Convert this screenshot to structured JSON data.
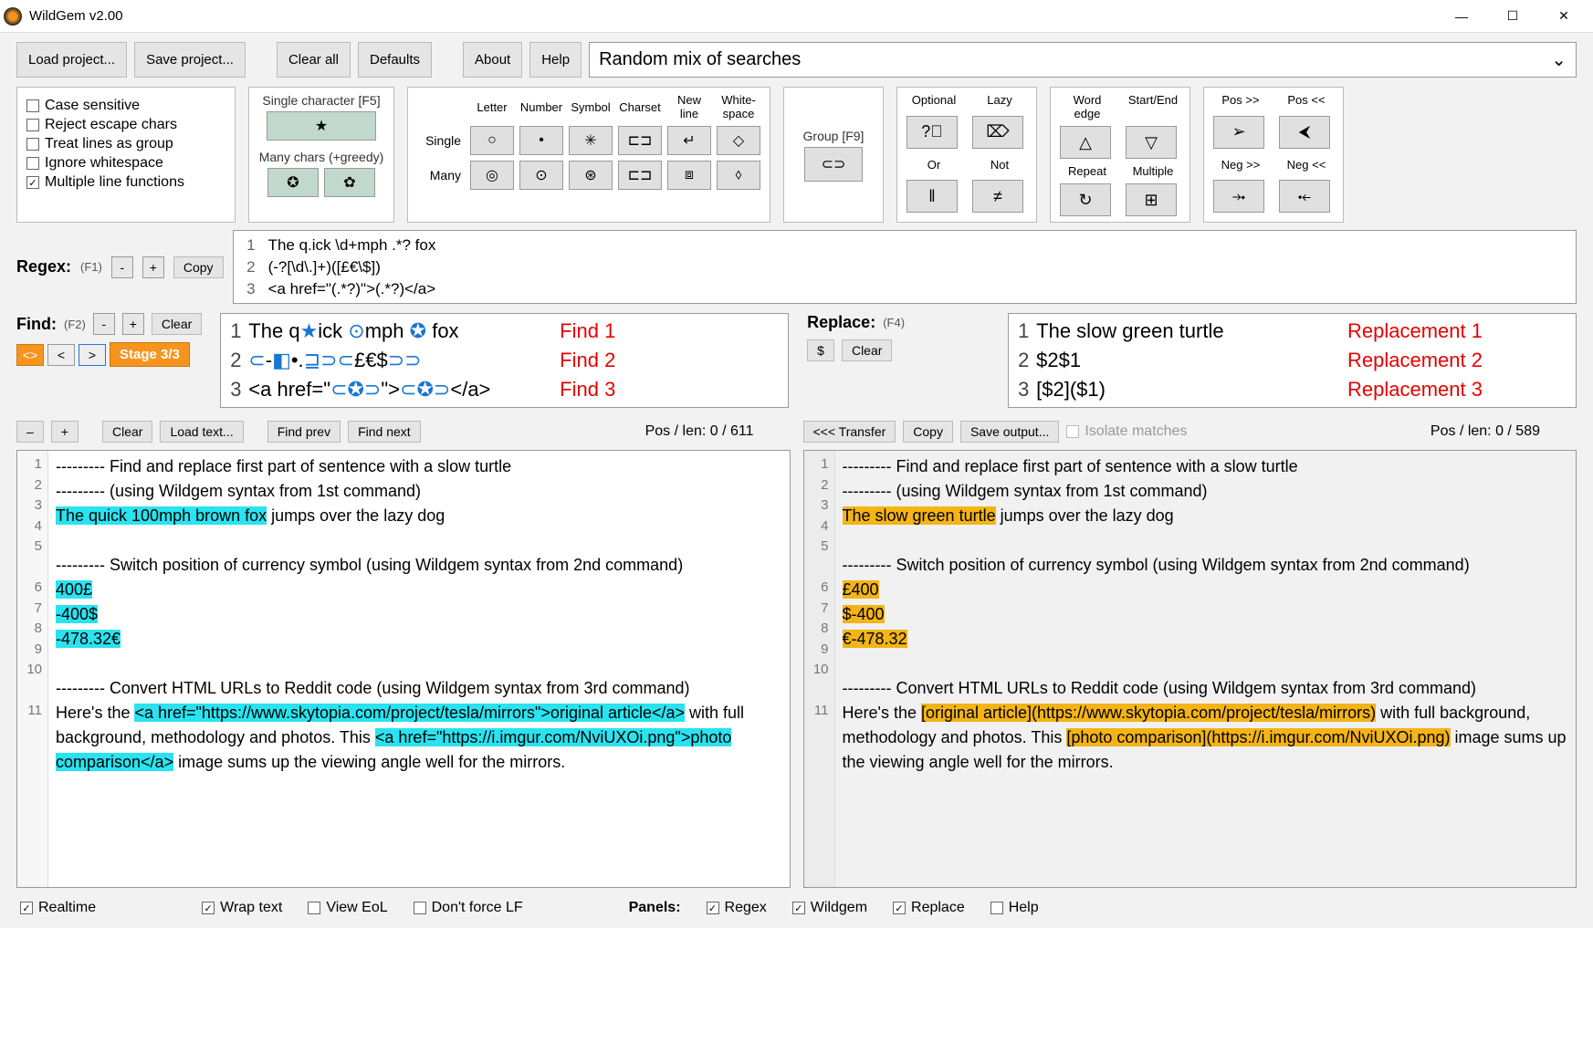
{
  "title": "WildGem v2.00",
  "toolbar": {
    "load": "Load project...",
    "save": "Save project...",
    "clear_all": "Clear all",
    "defaults": "Defaults",
    "about": "About",
    "help": "Help",
    "dropdown_selected": "Random mix of searches"
  },
  "options": {
    "case_sensitive": "Case sensitive",
    "reject_escape": "Reject escape chars",
    "treat_lines": "Treat lines as group",
    "ignore_ws": "Ignore whitespace",
    "multiline": "Multiple line functions"
  },
  "char_section": {
    "single_lbl": "Single character [F5]",
    "many_lbl": "Many chars  (+greedy)",
    "row_single": "Single",
    "row_many": "Many",
    "hdr_letter": "Letter",
    "hdr_number": "Number",
    "hdr_symbol": "Symbol",
    "hdr_charset": "Charset",
    "hdr_newline": "New line",
    "hdr_white": "White-\nspace",
    "group_lbl": "Group [F9]"
  },
  "mods": {
    "optional": "Optional",
    "lazy": "Lazy",
    "or": "Or",
    "not": "Not",
    "wordedge": "Word edge",
    "startend": "Start/End",
    "repeat": "Repeat",
    "multiple": "Multiple",
    "posf": "Pos >>",
    "posb": "Pos <<",
    "negf": "Neg >>",
    "negb": "Neg <<"
  },
  "regex": {
    "label": "Regex:",
    "hint": "(F1)",
    "copy": "Copy",
    "lines": [
      "The q.ick \\d+mph .*? fox",
      "(-?[\\d\\.]+)([£€\\$])",
      "<a href=\"(.*?)\">(.*?)</a>"
    ]
  },
  "find": {
    "label": "Find:",
    "hint": "(F2)",
    "clear": "Clear",
    "stage": "Stage 3/3",
    "lines": [
      {
        "txt": "The q★ick ⊙mph ✪ fox",
        "rl": "Find 1"
      },
      {
        "txt": "⊂-◧•.⊒⊃⊂£€$⊃⊃",
        "rl": "Find 2"
      },
      {
        "txt": "<a href=\"⊂✪⊃\">⊂✪⊃</a>",
        "rl": "Find 3"
      }
    ]
  },
  "replace": {
    "label": "Replace:",
    "hint": "(F4)",
    "dollar": "$",
    "clear": "Clear",
    "lines": [
      {
        "txt": "The slow green turtle",
        "rl": "Replacement 1"
      },
      {
        "txt": "$2$1",
        "rl": "Replacement 2"
      },
      {
        "txt": "[$2]($1)",
        "rl": "Replacement 3"
      }
    ]
  },
  "left_editor": {
    "btn_minus": "–",
    "btn_plus": "+",
    "clear": "Clear",
    "load": "Load text...",
    "prev": "Find prev",
    "next": "Find next",
    "pos": "Pos / len: 0 / 611"
  },
  "right_editor": {
    "transfer": "<<< Transfer",
    "copy": "Copy",
    "save": "Save output...",
    "isolate": "Isolate matches",
    "pos": "Pos / len: 0 / 589"
  },
  "text_left": {
    "l1": "--------- Find and replace first part of sentence with a slow turtle",
    "l2": "--------- (using Wildgem syntax from 1st command)",
    "l3a": "The quick 100mph brown fox",
    "l3b": " jumps over the lazy dog",
    "l5": "--------- Switch position of currency symbol (using Wildgem syntax from 2nd command)",
    "l6": "400£",
    "l7": "-400$",
    "l8": "-478.32€",
    "l10": "--------- Convert HTML URLs to Reddit code (using Wildgem syntax from 3rd command)",
    "l11a": "Here's the ",
    "l11b": "<a href=\"https://www.skytopia.com/project/tesla/mirrors\">original article</a>",
    "l11c": " with full background, methodology and photos. This ",
    "l11d": "<a href=\"https://i.imgur.com/NviUXOi.png\">photo comparison</a>",
    "l11e": " image sums up the viewing angle well for the mirrors."
  },
  "text_right": {
    "l1": "--------- Find and replace first part of sentence with a slow turtle",
    "l2": "--------- (using Wildgem syntax from 1st command)",
    "l3a": "The slow green turtle",
    "l3b": " jumps over the lazy dog",
    "l5": "--------- Switch position of currency symbol (using Wildgem syntax from 2nd command)",
    "l6": "£400",
    "l7": "$-400",
    "l8": "€-478.32",
    "l10": "--------- Convert HTML URLs to Reddit code (using Wildgem syntax from 3rd command)",
    "l11a": "Here's the ",
    "l11b": "[original article](https://www.skytopia.com/project/tesla/mirrors)",
    "l11c": " with full background, methodology and photos. This ",
    "l11d": "[photo comparison](https://i.imgur.com/NviUXOi.png)",
    "l11e": " image sums up the viewing angle well for the mirrors."
  },
  "bottom": {
    "realtime": "Realtime",
    "wrap": "Wrap text",
    "eol": "View EoL",
    "lf": "Don't force LF",
    "panels": "Panels:",
    "regex": "Regex",
    "wildgem": "Wildgem",
    "replace": "Replace",
    "help": "Help"
  }
}
